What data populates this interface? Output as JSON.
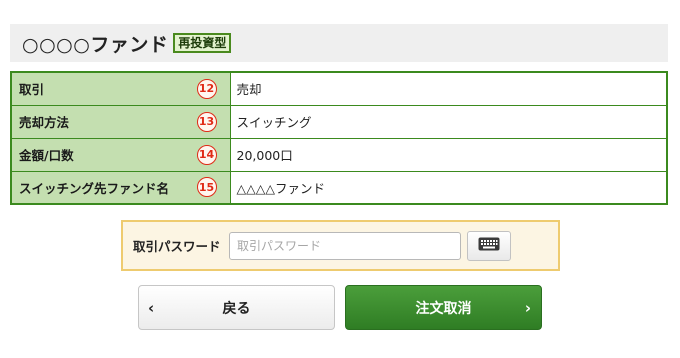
{
  "fund": {
    "name": "○○○○ファンド",
    "badge": "再投資型"
  },
  "rows": [
    {
      "label": "取引",
      "marker": "12",
      "value": "売却"
    },
    {
      "label": "売却方法",
      "marker": "13",
      "value": "スイッチング"
    },
    {
      "label": "金額/口数",
      "marker": "14",
      "value": "20,000口"
    },
    {
      "label": "スイッチング先ファンド名",
      "marker": "15",
      "value": "△△△△ファンド"
    }
  ],
  "password": {
    "label": "取引パスワード",
    "placeholder": "取引パスワード",
    "value": "",
    "keyboard_icon": "keyboard-icon"
  },
  "buttons": {
    "back_label": "戻る",
    "back_icon": "chevron-left-icon",
    "submit_label": "注文取消",
    "submit_icon": "chevron-right-icon"
  },
  "colors": {
    "table_border": "#3b8a1e",
    "label_bg": "#c4dfb0",
    "marker": "#e02a16",
    "submit_bg": "#3a8c2e",
    "password_bg": "#fcf5e3",
    "password_border": "#eecb6f"
  }
}
